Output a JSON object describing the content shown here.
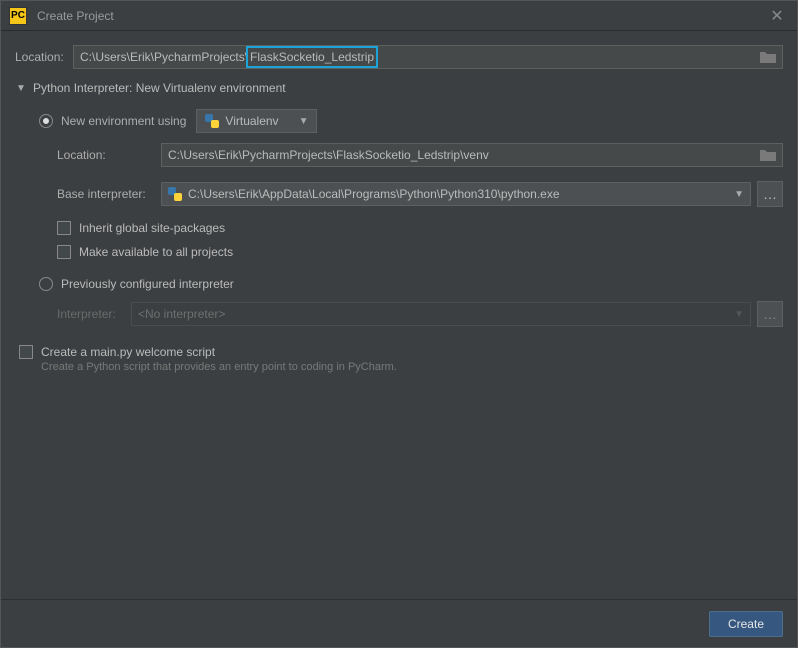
{
  "window": {
    "title": "Create Project",
    "app_icon": "PC"
  },
  "location": {
    "label": "Location:",
    "path_prefix": "C:\\Users\\Erik\\PycharmProjects\\",
    "project_name": "FlaskSocketio_Ledstrip"
  },
  "section": {
    "title": "Python Interpreter: New Virtualenv environment"
  },
  "new_env": {
    "radio_label": "New environment using",
    "tool": "Virtualenv",
    "location_label": "Location:",
    "location_value": "C:\\Users\\Erik\\PycharmProjects\\FlaskSocketio_Ledstrip\\venv",
    "base_label": "Base interpreter:",
    "base_value": "C:\\Users\\Erik\\AppData\\Local\\Programs\\Python\\Python310\\python.exe",
    "inherit_label": "Inherit global site-packages",
    "available_label": "Make available to all projects"
  },
  "prev_env": {
    "radio_label": "Previously configured interpreter",
    "interpreter_label": "Interpreter:",
    "interpreter_value": "<No interpreter>"
  },
  "mainpy": {
    "label": "Create a main.py welcome script",
    "helper": "Create a Python script that provides an entry point to coding in PyCharm."
  },
  "buttons": {
    "create": "Create"
  }
}
